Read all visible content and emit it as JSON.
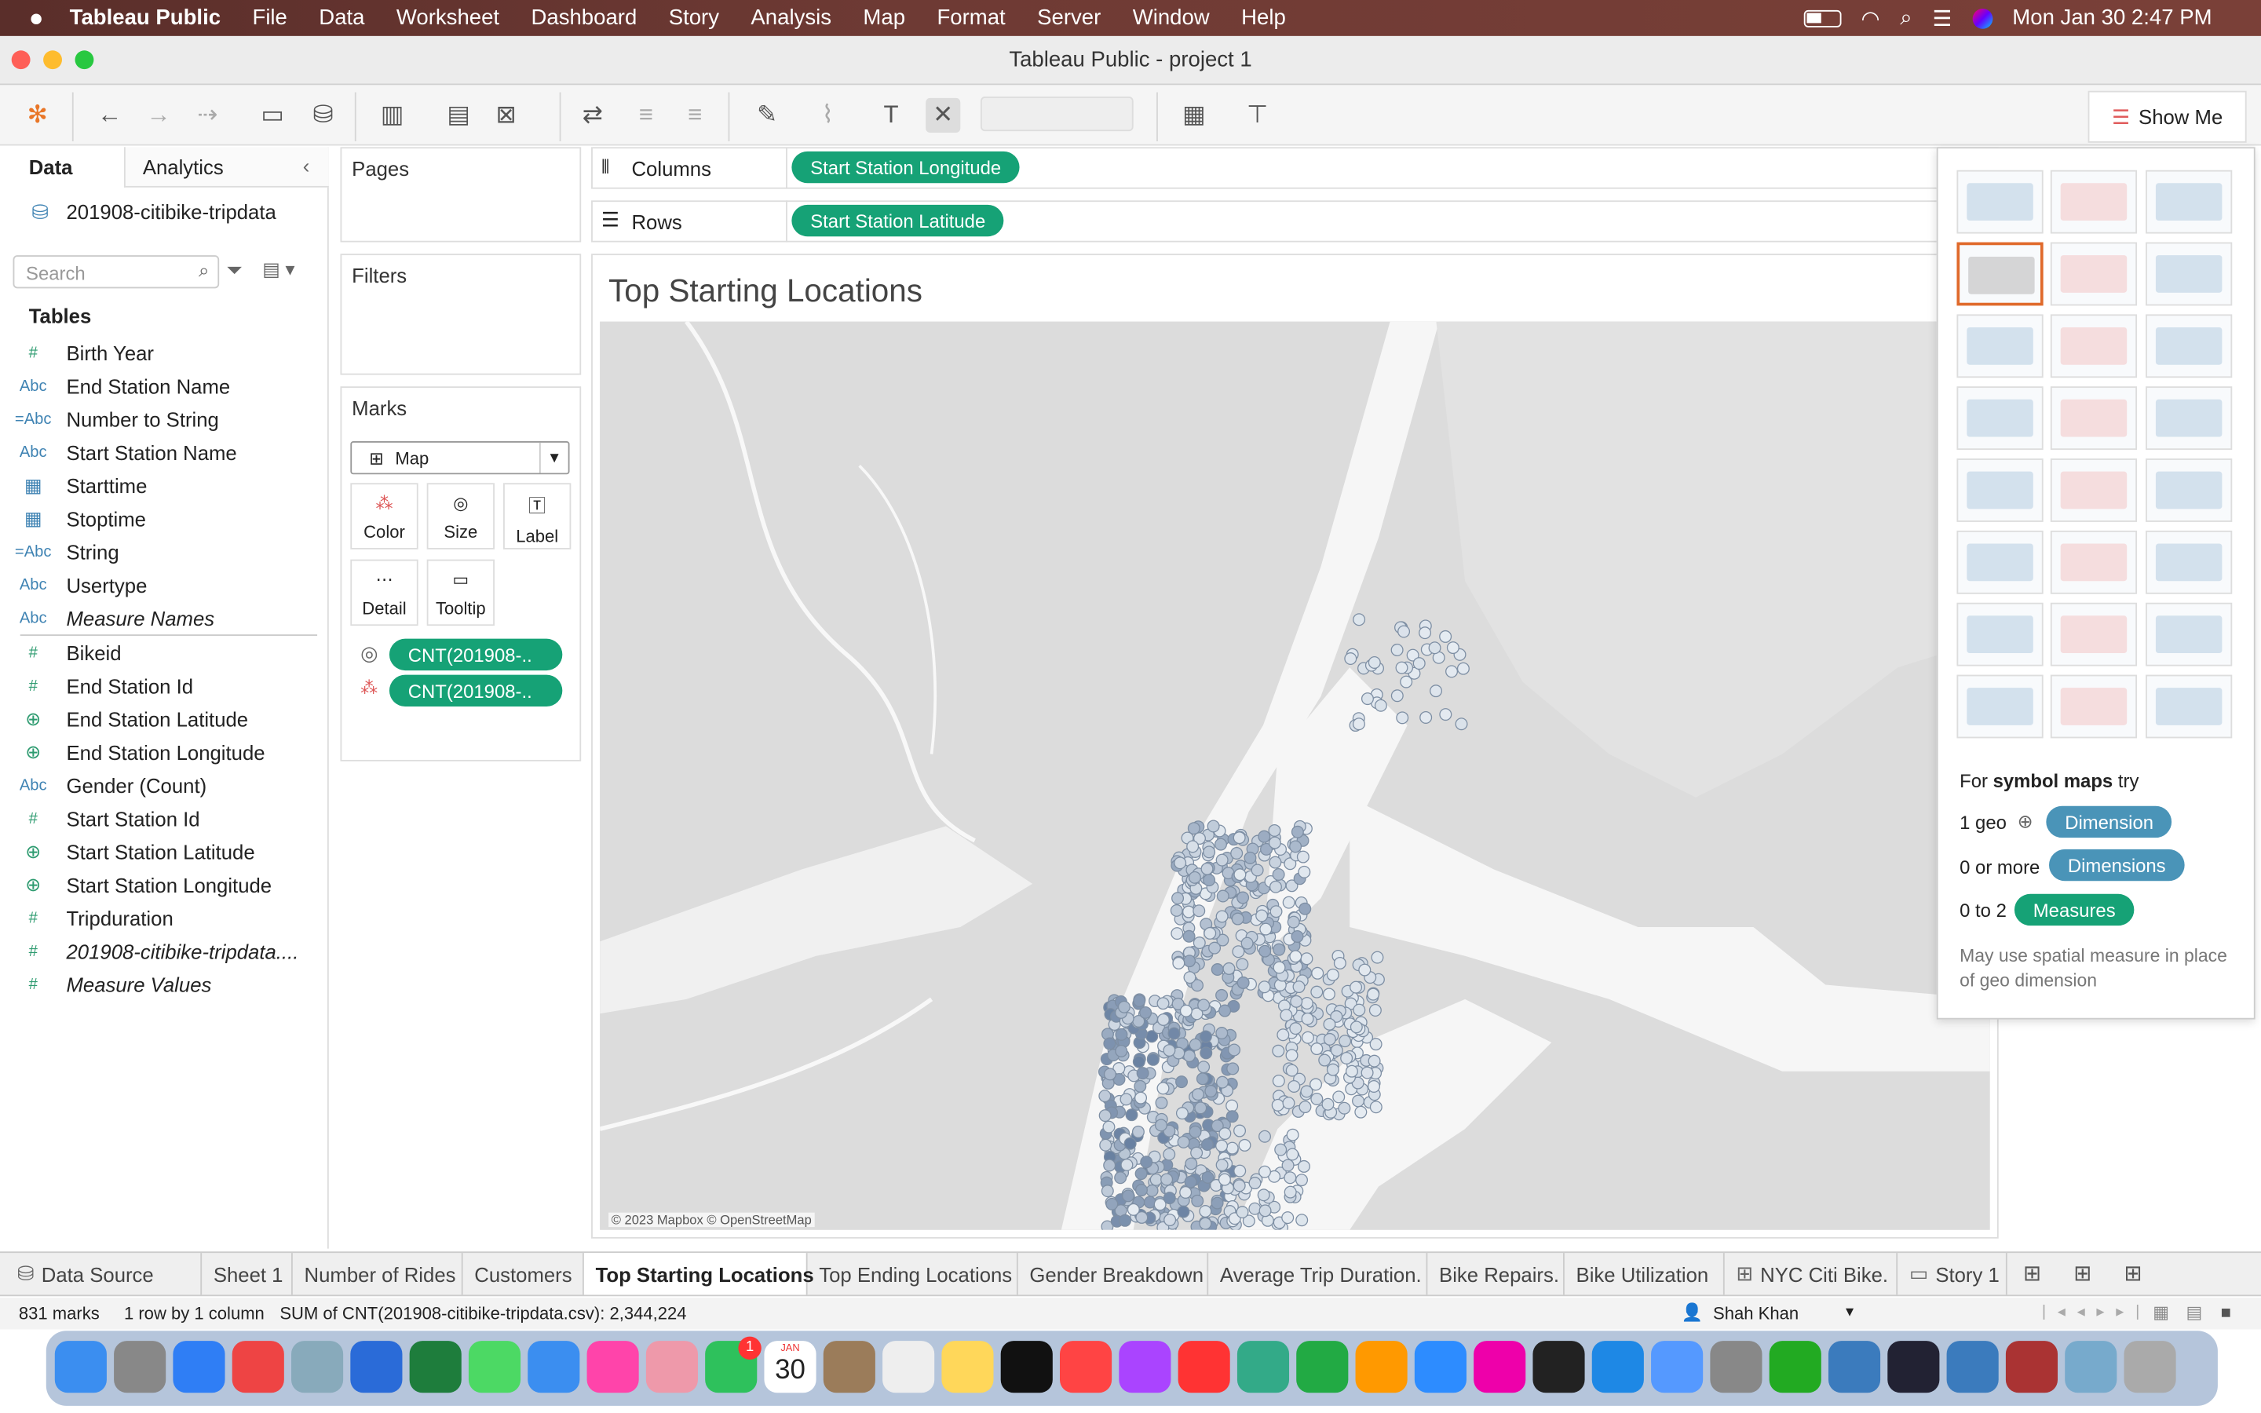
{
  "menubar": {
    "app": "Tableau Public",
    "items": [
      "File",
      "Data",
      "Worksheet",
      "Dashboard",
      "Story",
      "Analysis",
      "Map",
      "Format",
      "Server",
      "Window",
      "Help"
    ],
    "clock": "Mon Jan 30  2:47 PM"
  },
  "window": {
    "title": "Tableau Public - project 1"
  },
  "toolbar": {
    "show_me": "Show Me"
  },
  "data_pane": {
    "tab_data": "Data",
    "tab_analytics": "Analytics",
    "datasource": "201908-citibike-tripdata",
    "search_placeholder": "Search",
    "tables_heading": "Tables",
    "fields": [
      {
        "type": "#",
        "name": "Birth Year"
      },
      {
        "type": "Abc",
        "name": "End Station Name"
      },
      {
        "type": "=Abc",
        "name": "Number to String"
      },
      {
        "type": "Abc",
        "name": "Start Station Name"
      },
      {
        "type": "cal",
        "name": "Starttime"
      },
      {
        "type": "cal",
        "name": "Stoptime"
      },
      {
        "type": "=Abc",
        "name": "String"
      },
      {
        "type": "Abc",
        "name": "Usertype"
      },
      {
        "type": "Abc",
        "name": "Measure Names"
      },
      {
        "type": "#",
        "name": "Bikeid"
      },
      {
        "type": "#",
        "name": "End Station Id"
      },
      {
        "type": "geo",
        "name": "End Station Latitude"
      },
      {
        "type": "geo",
        "name": "End Station Longitude"
      },
      {
        "type": "Abc",
        "name": "Gender (Count)"
      },
      {
        "type": "#",
        "name": "Start Station Id"
      },
      {
        "type": "geo",
        "name": "Start Station Latitude"
      },
      {
        "type": "geo",
        "name": "Start Station Longitude"
      },
      {
        "type": "#",
        "name": "Tripduration"
      },
      {
        "type": "#",
        "name": "201908-citibike-tripdata...."
      },
      {
        "type": "#",
        "name": "Measure Values"
      }
    ]
  },
  "shelves": {
    "pages": "Pages",
    "filters": "Filters",
    "marks": "Marks",
    "mark_type": "Map",
    "mark_buttons": [
      "Color",
      "Size",
      "Label",
      "Detail",
      "Tooltip"
    ],
    "mark_pills": [
      "CNT(201908-..",
      "CNT(201908-.."
    ],
    "columns_label": "Columns",
    "rows_label": "Rows",
    "columns_pill": "Start Station Longitude",
    "rows_pill": "Start Station Latitude"
  },
  "view": {
    "title": "Top Starting Locations",
    "attribution": "© 2023 Mapbox © OpenStreetMap"
  },
  "show_me": {
    "hint_prefix": "For",
    "hint_bold": "symbol maps",
    "hint_suffix": "try",
    "req1_label": "1 geo",
    "req1_pill": "Dimension",
    "req2_label": "0 or more",
    "req2_pill": "Dimensions",
    "req3_label": "0 to 2",
    "req3_pill": "Measures",
    "note": "May use spatial measure in place of geo dimension"
  },
  "sheet_tabs": [
    "Data Source",
    "Sheet 1",
    "Number of Rides",
    "Customers",
    "Top Starting Locations",
    "Top Ending Locations",
    "Gender Breakdown",
    "Average Trip Duration.",
    "Bike Repairs.",
    "Bike Utilization",
    "NYC Citi Bike.",
    "Story 1"
  ],
  "active_tab": "Top Starting Locations",
  "status": {
    "marks": "831 marks",
    "dims": "1 row by 1 column",
    "sum": "SUM of CNT(201908-citibike-tripdata.csv): 2,344,224",
    "user": "Shah Khan"
  },
  "dock": {
    "calendar_day": "30",
    "calendar_month": "JAN",
    "facetime_badge": "1"
  }
}
